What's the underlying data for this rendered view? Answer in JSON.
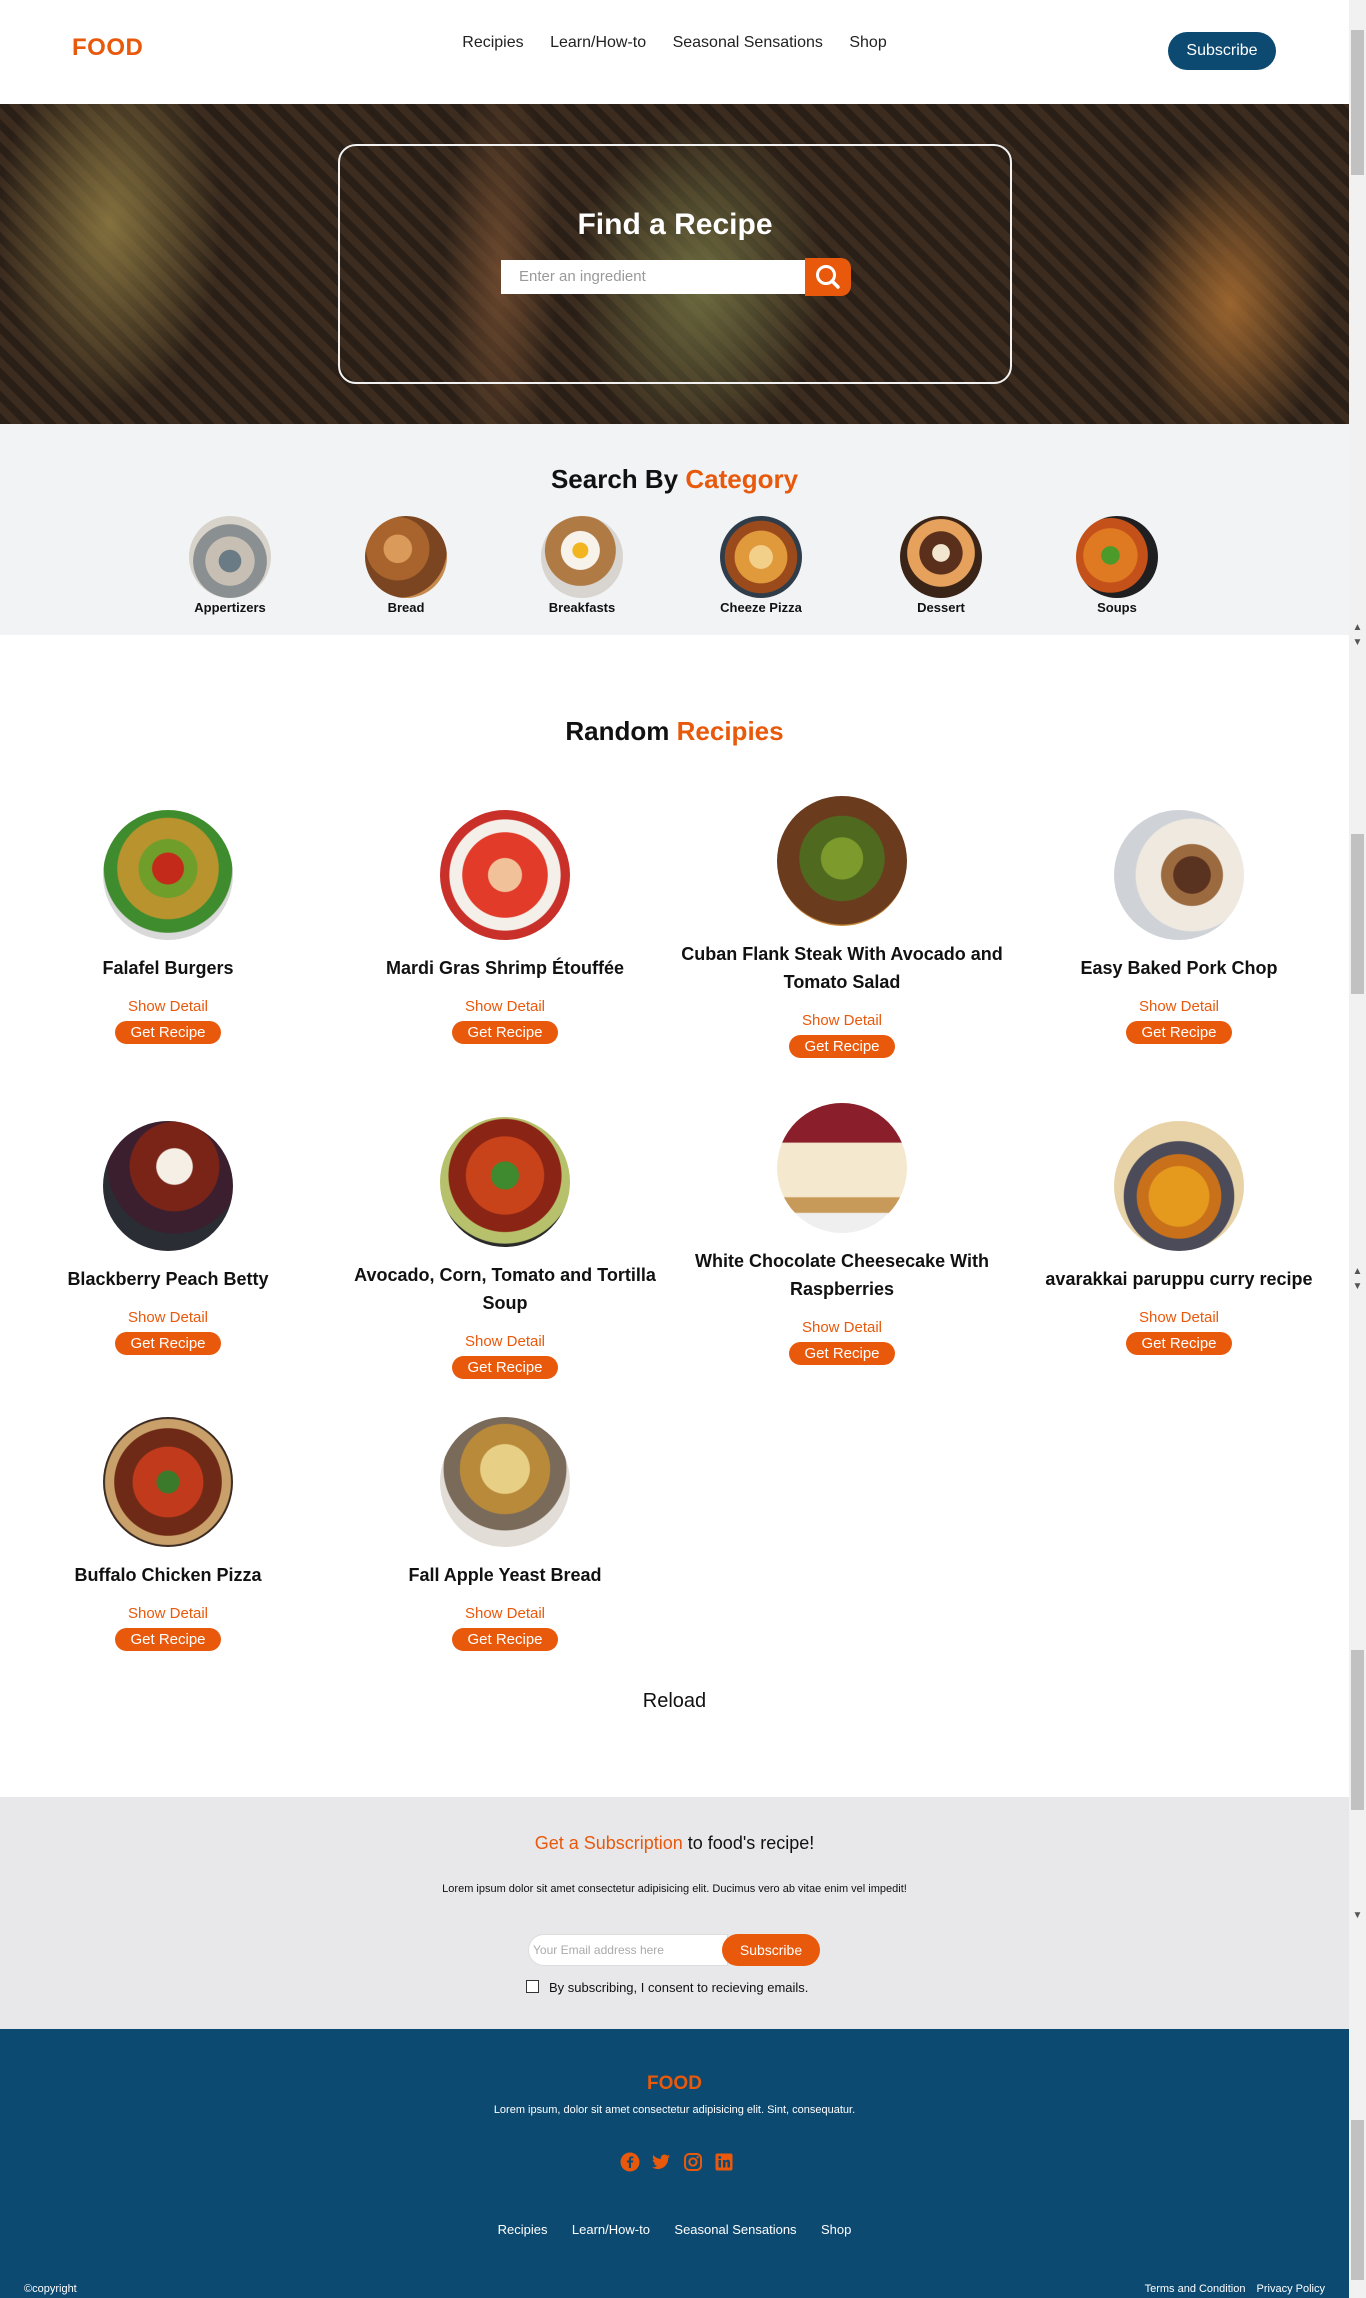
{
  "header": {
    "logo": "FOOD",
    "nav": [
      "Recipies",
      "Learn/How-to",
      "Seasonal Sensations",
      "Shop"
    ],
    "subscribe_label": "Subscribe"
  },
  "hero": {
    "title": "Find a Recipe",
    "search_placeholder": "Enter an ingredient",
    "search_icon": "search-icon"
  },
  "category": {
    "title_part1": "Search By",
    "title_part2": "Category",
    "items": [
      {
        "label": "Appertizers"
      },
      {
        "label": "Bread"
      },
      {
        "label": "Breakfasts"
      },
      {
        "label": "Cheeze Pizza"
      },
      {
        "label": "Dessert"
      },
      {
        "label": "Soups"
      }
    ]
  },
  "recipes": {
    "title_part1": "Random",
    "title_part2": "Recipies",
    "show_detail_label": "Show Detail",
    "get_recipe_label": "Get Recipe",
    "items": [
      {
        "name": "Falafel Burgers"
      },
      {
        "name": "Mardi Gras Shrimp Étouffée"
      },
      {
        "name": "Cuban Flank Steak With Avocado and Tomato Salad"
      },
      {
        "name": "Easy Baked Pork Chop"
      },
      {
        "name": "Blackberry Peach Betty"
      },
      {
        "name": "Avocado, Corn, Tomato and Tortilla Soup"
      },
      {
        "name": "White Chocolate Cheesecake With Raspberries"
      },
      {
        "name": "avarakkai paruppu curry recipe"
      },
      {
        "name": "Buffalo Chicken Pizza"
      },
      {
        "name": "Fall Apple Yeast Bread"
      }
    ],
    "reload_label": "Reload"
  },
  "subscription": {
    "heading_highlight": "Get a Subscription",
    "heading_rest": " to food's recipe!",
    "text": "Lorem ipsum dolor sit amet consectetur adipisicing elit. Ducimus vero ab vitae enim vel impedit!",
    "email_placeholder": "Your Email address here",
    "button_label": "Subscribe",
    "consent_label": "By subscribing, I consent to recieving emails."
  },
  "footer": {
    "logo": "FOOD",
    "text": "Lorem ipsum, dolor sit amet consectetur adipisicing elit. Sint, consequatur.",
    "socials": [
      "facebook-icon",
      "twitter-icon",
      "instagram-icon",
      "linkedin-icon"
    ],
    "nav": [
      "Recipies",
      "Learn/How-to",
      "Seasonal Sensations",
      "Shop"
    ],
    "copyright": "©copyright",
    "terms_label": "Terms and Condition",
    "privacy_label": "Privacy Policy"
  },
  "colors": {
    "accent": "#e8590c",
    "navy": "#0d4a72",
    "category_bg": "#f2f3f5",
    "subscription_bg": "#e8e8eb"
  }
}
